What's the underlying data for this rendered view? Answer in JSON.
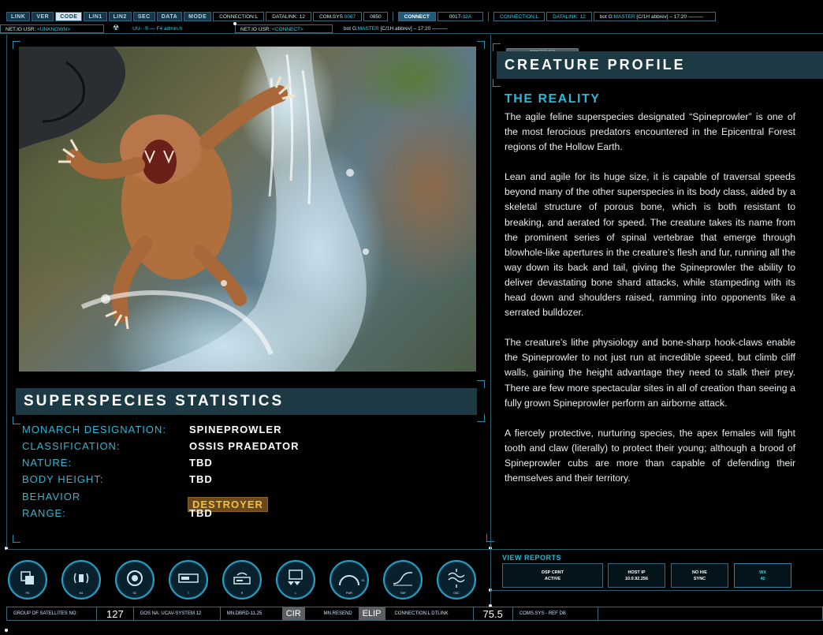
{
  "topbar": {
    "tabs": [
      "LINK",
      "VER",
      "CODE",
      "LIN1",
      "LIN2",
      "SEC",
      "DATA",
      "MODE"
    ],
    "active_tab": "CODE",
    "connection": "CONNECTION:L",
    "datalink": "DATALINK: 12",
    "comsys_label": "COM.SYS",
    "comsys_value": "0067",
    "code": "0850",
    "connect_label": "CONNECT",
    "code2_prefix": "0017-",
    "code2_value": "32A",
    "connection2": "CONNECTION:L",
    "datalink2": "DATALINK: 12",
    "bot_prefix": "bot G:",
    "bot_master": "MASTER",
    "bot_suffix": " [C/1H abbrev] – 17:20 ———"
  },
  "subbar": {
    "netio_label": "NET.IO USR: ",
    "netio_value": "<UNKNOWN>",
    "admin_text": "·UU· ·® — F4 admin.h",
    "netio2_label": "NET.IO USR: ",
    "netio2_value": "<CONNECT>",
    "bot_prefix": "bot G:",
    "bot_master": "MASTER",
    "bot_suffix": " [C/1H abbrev] – 17:20 ———",
    "slider_label": "PERMITTED SIZE"
  },
  "stats": {
    "title": "SUPERSPECIES STATISTICS",
    "rows": [
      {
        "label": "MONARCH DESIGNATION:",
        "value": "SPINEPROWLER"
      },
      {
        "label": "CLASSIFICATION:",
        "value": "OSSIS PRAEDATOR"
      },
      {
        "label": "NATURE:",
        "value": "TBD"
      },
      {
        "label": "BODY HEIGHT:",
        "value": "TBD"
      },
      {
        "label": "BEHAVIOR",
        "value": "DESTROYER"
      },
      {
        "label": "RANGE:",
        "value": "TBD"
      }
    ]
  },
  "profile": {
    "title": "CREATURE PROFILE",
    "subtitle": "THE REALITY",
    "paragraphs": [
      "The agile feline superspecies designated “Spineprowler” is one of the most ferocious predators encountered in the Epicentral Forest regions of the Hollow Earth.",
      "Lean and agile for its huge size, it is capable of traversal speeds beyond many of the other superspecies in its body class, aided by a skeletal structure of porous bone, which is both resistant to breaking, and aerated for speed. The creature takes its name from the prominent series of spinal vertebrae that emerge through blowhole-like apertures in the creature’s flesh and fur, running all the way down its back and tail, giving the Spineprowler the ability to deliver devastating bone shard attacks, while stampeding with its head down and shoulders raised, ramming into opponents like a serrated bulldozer.",
      "The creature’s lithe physiology and bone-sharp hook-claws enable the Spineprowler to not just run at incredible speed, but climb cliff walls, gaining the height advantage they need to stalk their prey. There are few more spectacular sites in all of creation than seeing a fully grown Spineprowler perform an airborne attack.",
      "A fiercely protective, nurturing species, the apex females will fight tooth and claw (literally) to protect their young; although a brood of Spineprowler cubs are more than capable of defending their themselves and their territory."
    ]
  },
  "controls": [
    {
      "name": "layers-icon",
      "label": "PS"
    },
    {
      "name": "signal-icon",
      "label": "M1"
    },
    {
      "name": "lens-icon",
      "label": "SC"
    },
    {
      "name": "device-icon",
      "label": "T"
    },
    {
      "name": "radio-icon",
      "label": "R"
    },
    {
      "name": "monitor-icon",
      "label": "L"
    },
    {
      "name": "gauge-icon",
      "label": "PWR",
      "extra": "OL"
    },
    {
      "name": "wave-curve-icon",
      "label": "TMP"
    },
    {
      "name": "oscillator-icon",
      "label": "OSC"
    }
  ],
  "reports": {
    "title": "VIEW REPORTS",
    "boxes": [
      {
        "line1": "DSP CRNT",
        "line2": "ACTIVE"
      },
      {
        "line1": "HOST IP",
        "line2": "10.0.92.256"
      },
      {
        "line1": "NO H/E",
        "line2": "SYNC"
      },
      {
        "line1": "WX",
        "line2": "40"
      }
    ]
  },
  "footer": {
    "satellites_label": "GROUP OF SATELLITES NO:",
    "satellites_value": "127",
    "gos": "GOS NA: UCAV-SYSTEM 12",
    "dbrd": "MN.DBRD-11.25",
    "cir": "CIR",
    "resend": "MN.RESEND",
    "elip": "ELIP",
    "connection": "CONNECTION:L DTLINK",
    "value": "75.5",
    "comsys": "COMS.SYS - REF DB"
  },
  "colors": {
    "accent": "#2cb8d4",
    "panel": "#1d3a44",
    "badge_bg": "#6a4a1c",
    "badge_text": "#f0c040"
  }
}
